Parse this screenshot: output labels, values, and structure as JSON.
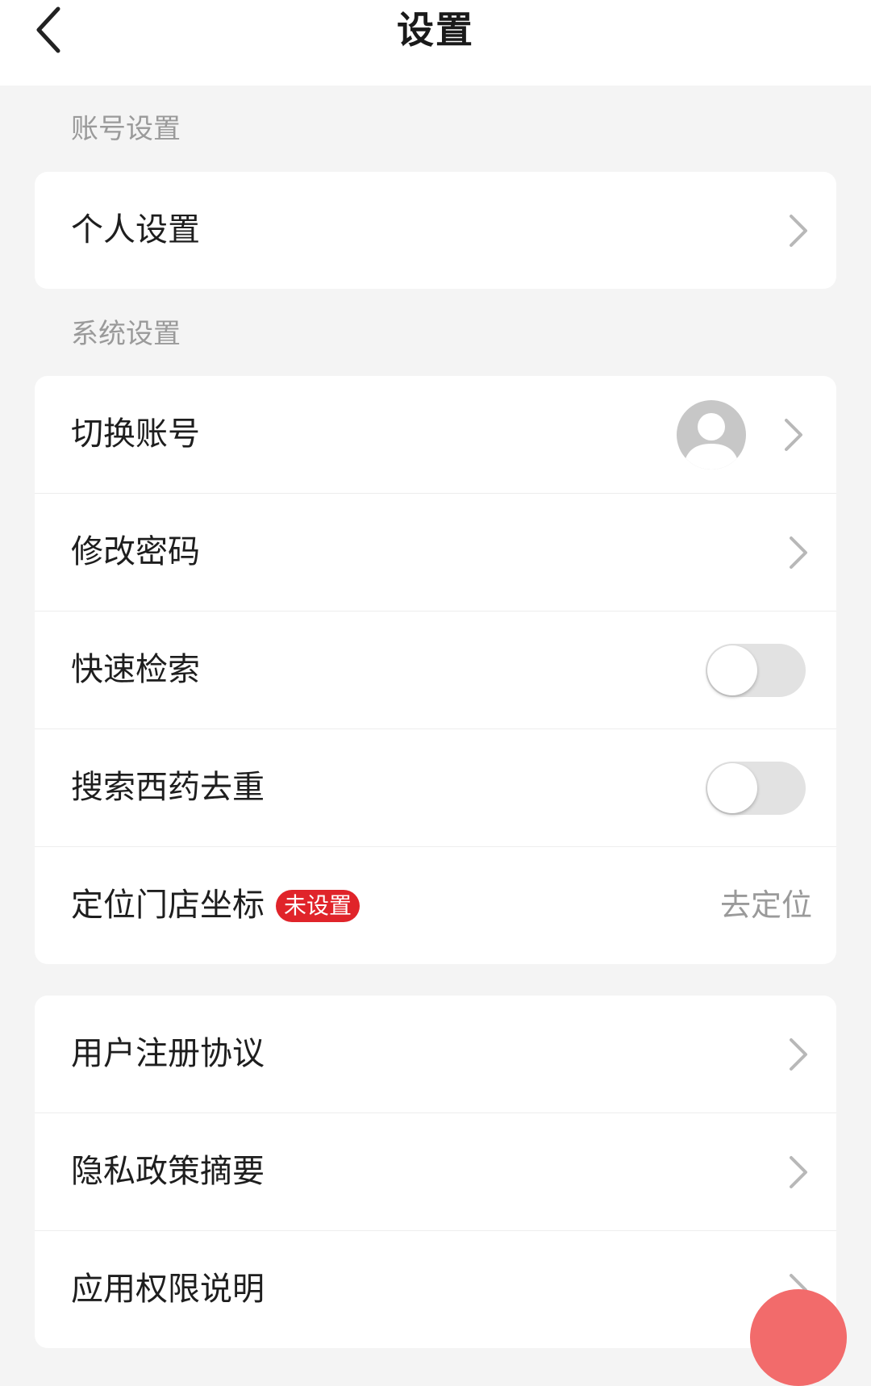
{
  "header": {
    "title": "设置"
  },
  "sections": {
    "account": {
      "title": "账号设置",
      "items": [
        {
          "label": "个人设置"
        }
      ]
    },
    "system": {
      "title": "系统设置",
      "items": [
        {
          "label": "切换账号"
        },
        {
          "label": "修改密码"
        },
        {
          "label": "快速检索",
          "toggle": false
        },
        {
          "label": "搜索西药去重",
          "toggle": false
        },
        {
          "label": "定位门店坐标",
          "badge": "未设置",
          "value": "去定位"
        }
      ]
    },
    "legal": {
      "items": [
        {
          "label": "用户注册协议"
        },
        {
          "label": "隐私政策摘要"
        },
        {
          "label": "应用权限说明"
        }
      ]
    }
  },
  "icons": {
    "back": "chevron-left-icon",
    "chevron": "chevron-right-icon",
    "avatar": "user-avatar-icon"
  },
  "colors": {
    "background": "#f4f4f4",
    "card": "#ffffff",
    "badge": "#e0242a",
    "muted_text": "#9a9a9a",
    "toggle_off": "#e2e2e2"
  }
}
